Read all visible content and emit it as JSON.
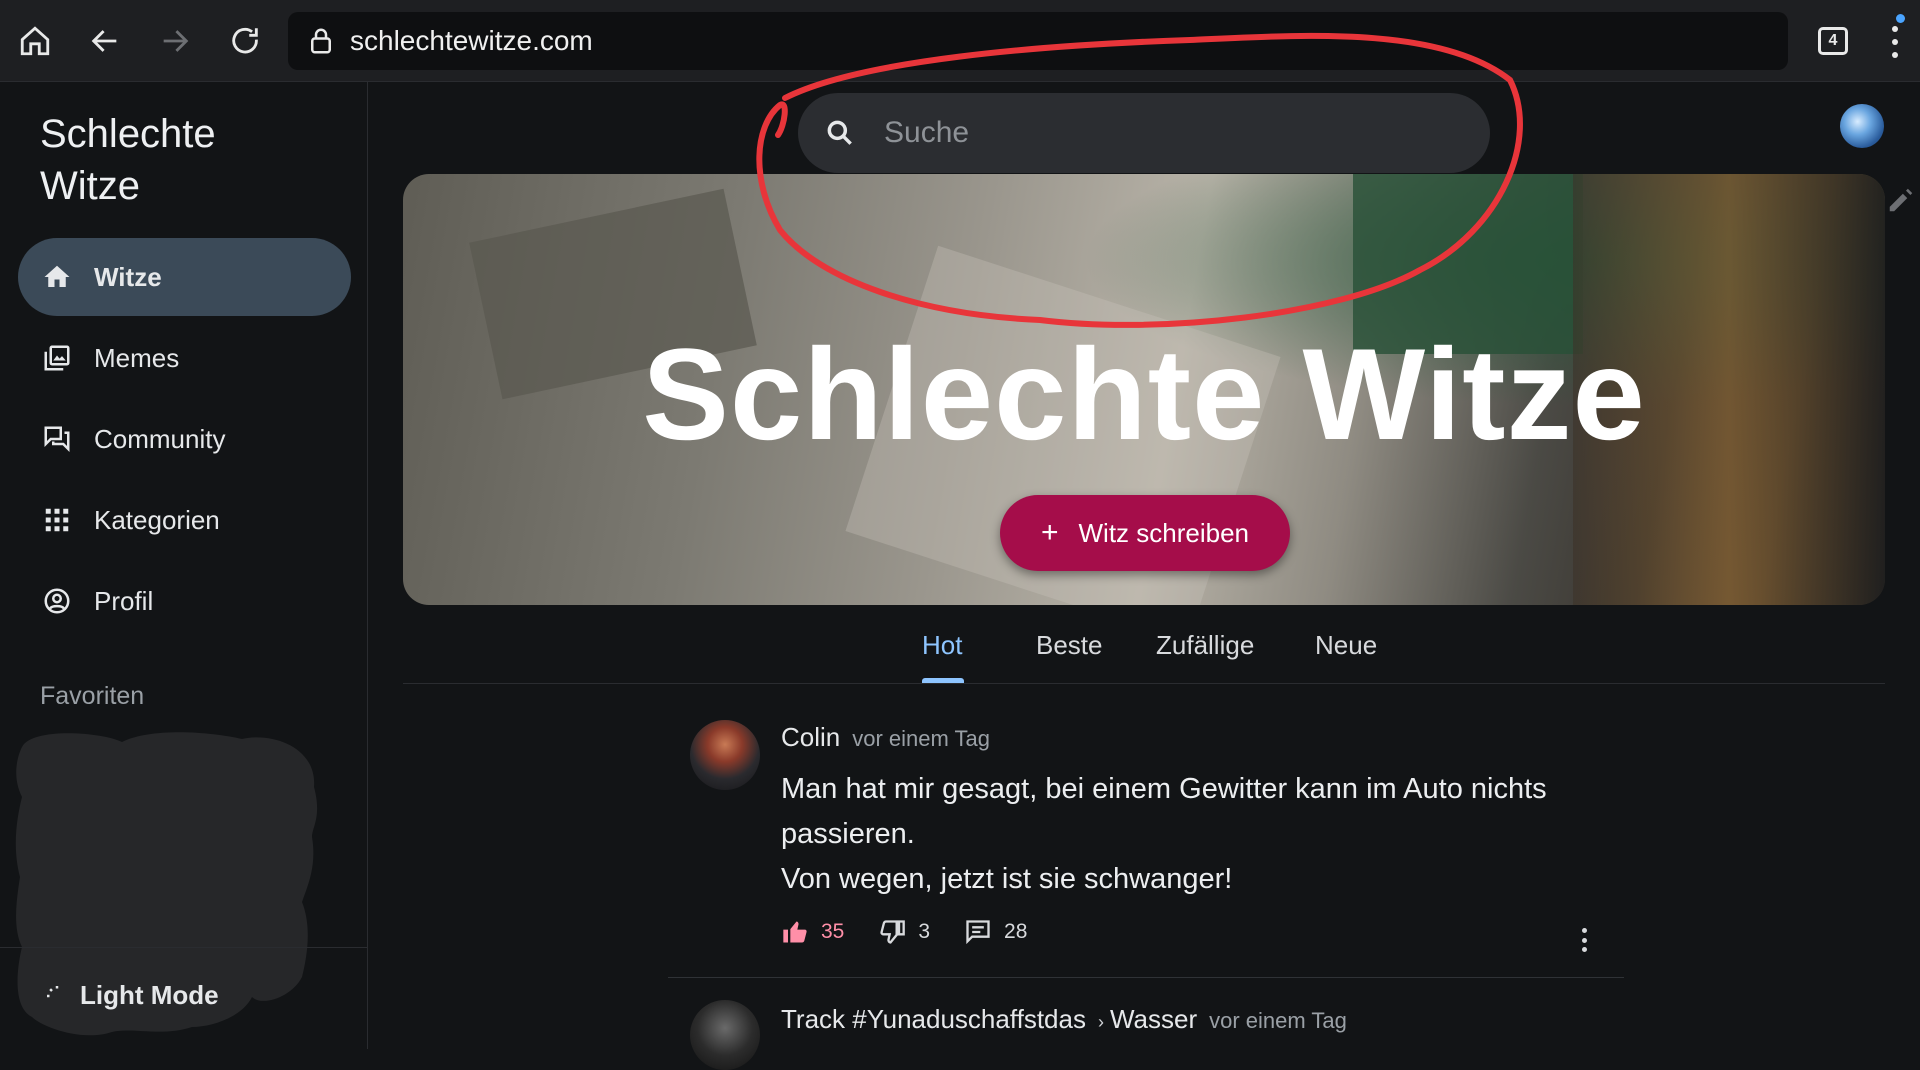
{
  "browser": {
    "url": "schlechtewitze.com",
    "tab_count": "4"
  },
  "sidebar": {
    "brand_line1": "Schlechte",
    "brand_line2": "Witze",
    "items": [
      {
        "label": "Witze",
        "icon": "home-icon",
        "active": true
      },
      {
        "label": "Memes",
        "icon": "image-gallery-icon",
        "active": false
      },
      {
        "label": "Community",
        "icon": "forum-icon",
        "active": false
      },
      {
        "label": "Kategorien",
        "icon": "grid-icon",
        "active": false
      },
      {
        "label": "Profil",
        "icon": "account-circle-icon",
        "active": false
      }
    ],
    "favorites_label": "Favoriten",
    "light_mode_label": "Light Mode"
  },
  "search": {
    "placeholder": "Suche"
  },
  "hero": {
    "title": "Schlechte Witze",
    "cta_label": "Witz schreiben",
    "cta_plus": "+"
  },
  "tabs": [
    {
      "label": "Hot",
      "active": true
    },
    {
      "label": "Beste",
      "active": false
    },
    {
      "label": "Zufällige",
      "active": false
    },
    {
      "label": "Neue",
      "active": false
    }
  ],
  "posts": [
    {
      "author": "Colin",
      "time": "vor einem Tag",
      "body_lines": [
        "Man hat mir gesagt, bei einem Gewitter kann im Auto nichts",
        "passieren.",
        "Von wegen, jetzt ist sie schwanger!"
      ],
      "likes": "35",
      "dislikes": "3",
      "comments": "28"
    },
    {
      "author": "Track #Yunaduschaffstdas",
      "category": "Wasser",
      "time": "vor einem Tag"
    }
  ],
  "colors": {
    "accent": "#8ec5ff",
    "cta": "#a50d4a",
    "annotation": "#e8353a",
    "active_nav": "#3b4a58"
  }
}
